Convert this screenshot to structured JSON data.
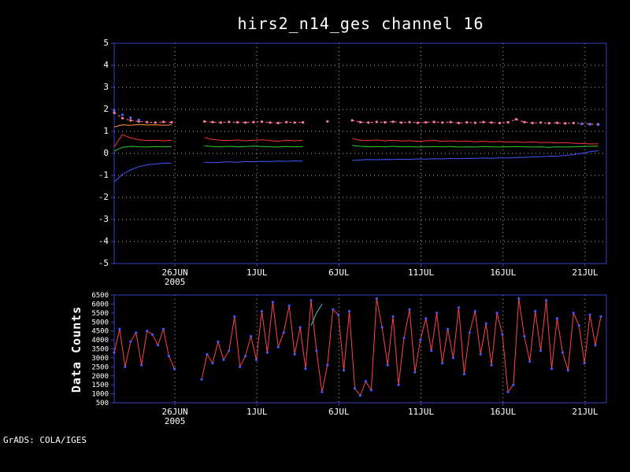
{
  "header": {
    "title": "hirs2_n14_ges channel 16"
  },
  "footer": {
    "credit": "GrADS: COLA/IGES"
  },
  "colors": {
    "background": "#000000",
    "frame": "#3b3bcc",
    "grid": "#b0b0b0",
    "text": "#ffffff"
  },
  "chart_data": [
    {
      "name": "top-chart",
      "type": "line",
      "xlabel": "",
      "ylabel": "",
      "xlim": [
        0,
        30
      ],
      "ylim": [
        -5,
        5
      ],
      "grid_h": true,
      "grid_v": true,
      "tick_font": 11,
      "y_ticks": [
        5,
        4,
        3,
        2,
        1,
        0,
        -1,
        -2,
        -3,
        -4,
        -5
      ],
      "x_ticks": [
        {
          "pos": 3.7,
          "label": "26JUN",
          "sub": "2005"
        },
        {
          "pos": 8.7,
          "label": "1JUL"
        },
        {
          "pos": 13.7,
          "label": "6JUL"
        },
        {
          "pos": 18.7,
          "label": "11JUL"
        },
        {
          "pos": 23.7,
          "label": "16JUL"
        },
        {
          "pos": 28.7,
          "label": "21JUL"
        }
      ],
      "series": [
        {
          "name": "stddev-dotted-pink",
          "color": "#ff7799",
          "line": true,
          "dash": "3,3",
          "marker": true,
          "x_start": 0,
          "x_step": 0.5,
          "values": [
            1.85,
            1.6,
            1.5,
            1.45,
            1.42,
            1.4,
            1.43,
            1.41,
            null,
            null,
            null,
            1.45,
            1.42,
            1.4,
            1.43,
            1.41,
            1.4,
            1.42,
            1.44,
            1.4,
            1.38,
            1.42,
            1.4,
            1.41,
            null,
            null,
            1.45,
            null,
            null,
            1.5,
            1.42,
            1.4,
            1.43,
            1.41,
            1.44,
            1.4,
            1.42,
            1.39,
            1.41,
            1.43,
            1.4,
            1.42,
            1.38,
            1.41,
            1.39,
            1.42,
            1.4,
            1.38,
            1.41,
            1.55,
            1.42,
            1.38,
            1.4,
            1.37,
            1.39,
            1.36,
            1.38,
            1.35,
            1.33,
            1.32
          ]
        },
        {
          "name": "blue-dots",
          "color": "#5566ff",
          "line": false,
          "marker": true,
          "x": [
            0,
            0.5,
            1,
            1.5,
            28.5,
            29,
            29.5
          ],
          "values": [
            1.95,
            1.75,
            1.62,
            1.52,
            1.34,
            1.31,
            1.3
          ]
        },
        {
          "name": "orange-start-segment",
          "color": "#ff9933",
          "line": true,
          "marker": false,
          "x_start": 0,
          "x_step": 0.5,
          "values": [
            1.2,
            1.3,
            1.28,
            1.31,
            1.29,
            1.3,
            1.28,
            1.3
          ]
        },
        {
          "name": "mean-red",
          "color": "#ff3333",
          "line": true,
          "marker": false,
          "x_start": 0,
          "x_step": 0.5,
          "values": [
            0.3,
            0.85,
            0.7,
            0.62,
            0.58,
            0.6,
            0.57,
            0.6,
            null,
            null,
            null,
            0.72,
            0.63,
            0.6,
            0.58,
            0.61,
            0.57,
            0.6,
            0.62,
            0.58,
            0.55,
            0.6,
            0.57,
            0.59,
            null,
            null,
            0.63,
            null,
            null,
            0.68,
            0.6,
            0.58,
            0.61,
            0.57,
            0.6,
            0.56,
            0.58,
            0.55,
            0.57,
            0.59,
            0.55,
            0.57,
            0.54,
            0.56,
            0.53,
            0.55,
            0.52,
            0.54,
            0.51,
            0.53,
            0.5,
            0.52,
            0.49,
            0.5,
            0.47,
            0.49,
            0.46,
            0.45,
            0.43,
            0.44
          ]
        },
        {
          "name": "mean-green",
          "color": "#33cc33",
          "line": true,
          "marker": false,
          "x_start": 0,
          "x_step": 0.5,
          "values": [
            0.1,
            0.28,
            0.32,
            0.3,
            0.29,
            0.31,
            0.3,
            0.31,
            null,
            null,
            null,
            0.34,
            0.31,
            0.3,
            0.32,
            0.3,
            0.31,
            0.33,
            0.31,
            0.3,
            0.29,
            0.31,
            0.3,
            0.31,
            null,
            null,
            0.33,
            null,
            null,
            0.36,
            0.32,
            0.3,
            0.31,
            0.3,
            0.32,
            0.3,
            0.31,
            0.29,
            0.3,
            0.31,
            0.3,
            0.31,
            0.29,
            0.3,
            0.29,
            0.31,
            0.3,
            0.29,
            0.3,
            0.31,
            0.3,
            0.29,
            0.3,
            0.28,
            0.3,
            0.29,
            0.3,
            0.31,
            0.32,
            0.33
          ]
        },
        {
          "name": "mean-blue",
          "color": "#4455ff",
          "line": true,
          "marker": false,
          "x_start": 0,
          "x_step": 0.5,
          "values": [
            -1.3,
            -0.95,
            -0.75,
            -0.6,
            -0.52,
            -0.48,
            -0.45,
            -0.44,
            null,
            null,
            null,
            -0.4,
            -0.42,
            -0.4,
            -0.38,
            -0.4,
            -0.37,
            -0.38,
            -0.36,
            -0.37,
            -0.35,
            -0.36,
            -0.34,
            -0.35,
            null,
            null,
            -0.3,
            null,
            null,
            -0.32,
            -0.3,
            -0.28,
            -0.29,
            -0.27,
            -0.28,
            -0.26,
            -0.27,
            -0.25,
            -0.26,
            -0.24,
            -0.25,
            -0.23,
            -0.24,
            -0.22,
            -0.23,
            -0.21,
            -0.22,
            -0.2,
            -0.21,
            -0.19,
            -0.18,
            -0.16,
            -0.15,
            -0.13,
            -0.12,
            -0.1,
            -0.05,
            0.0,
            0.08,
            0.12
          ]
        }
      ]
    },
    {
      "name": "bottom-chart",
      "type": "line",
      "xlabel": "",
      "ylabel": "Data Counts",
      "xlim": [
        0,
        30
      ],
      "ylim": [
        500,
        6500
      ],
      "grid_h": false,
      "grid_v": true,
      "tick_font": 9,
      "y_ticks": [
        6500,
        6000,
        5500,
        5000,
        4500,
        4000,
        3500,
        3000,
        2500,
        2000,
        1500,
        1000,
        500
      ],
      "x_ticks": [
        {
          "pos": 3.7,
          "label": "26JUN",
          "sub": "2005"
        },
        {
          "pos": 8.7,
          "label": "1JUL"
        },
        {
          "pos": 13.7,
          "label": "6JUL"
        },
        {
          "pos": 18.7,
          "label": "11JUL"
        },
        {
          "pos": 23.7,
          "label": "16JUL"
        },
        {
          "pos": 28.7,
          "label": "21JUL"
        }
      ],
      "series": [
        {
          "name": "data-counts",
          "color": "#ff4444",
          "marker_color": "#4455ff",
          "line": true,
          "marker": true,
          "x_start": 0,
          "x_step": 0.3333,
          "values": [
            3300,
            4600,
            2500,
            3900,
            4400,
            2600,
            4500,
            4300,
            3700,
            4600,
            3100,
            2400,
            null,
            null,
            null,
            null,
            1800,
            3200,
            2700,
            3900,
            2900,
            3400,
            5300,
            2500,
            3100,
            4200,
            2900,
            5600,
            3300,
            6100,
            3600,
            4400,
            5900,
            3200,
            4700,
            2400,
            6200,
            3400,
            1100,
            2600,
            5700,
            5400,
            2300,
            5600,
            1300,
            900,
            1700,
            1200,
            6300,
            4700,
            2600,
            5300,
            1500,
            4100,
            5700,
            2200,
            4000,
            5200,
            3400,
            5500,
            2700,
            4600,
            3000,
            5800,
            2100,
            4400,
            5600,
            3200,
            4900,
            2600,
            5500,
            4300,
            1100,
            1500,
            6300,
            4200,
            2800,
            5600,
            3400,
            6200,
            2400,
            5200,
            3300,
            2300,
            5500,
            4800,
            2700,
            5400,
            3700,
            5300
          ]
        },
        {
          "name": "teal-segment",
          "color": "#33cccc",
          "line": true,
          "marker": false,
          "x": [
            12.0,
            12.33,
            12.67
          ],
          "values": [
            4800,
            5500,
            6000
          ]
        }
      ]
    }
  ]
}
